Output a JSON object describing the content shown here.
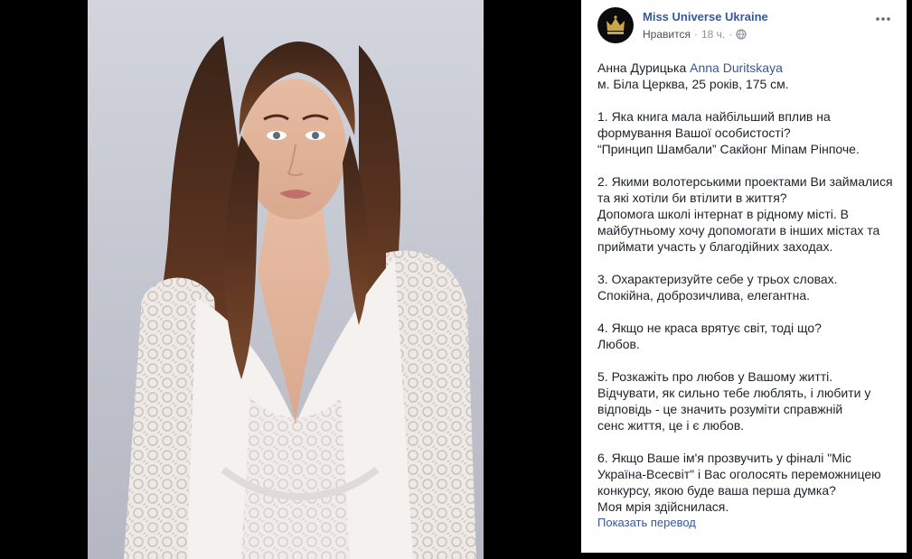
{
  "post": {
    "page_name": "Miss Universe Ukraine",
    "liked_label": "Нравится",
    "time": "18 ч.",
    "separator": "·",
    "audience_icon": "globe-icon",
    "more_icon": "more-options-icon"
  },
  "text": {
    "intro_name": "Анна Дурицька",
    "intro_mention": "Anna Duritskaya",
    "intro_line2": "м. Біла Церква, 25 років, 175 см.",
    "q1": "1. Яка книга мала найбільший вплив на",
    "q1b": "формування Вашої особистості?",
    "a1": "“Принцип Шамбали” Сакйонг Міпам Рінпоче.",
    "q2": "2. Якими волотерськими проектами Ви займалися",
    "q2b": "та які хотіли би втілити в життя?",
    "a2a": "Допомога школі інтернат в рідному місті. В",
    "a2b": "майбутньому хочу допомогати в інших містах та",
    "a2c": "приймати участь у благодійних заходах.",
    "q3": "3. Охарактеризуйте себе у трьох словах.",
    "a3": "Спокійна, доброзичлива, елегантна.",
    "q4": "4. Якщо не краса врятує світ, тоді що?",
    "a4": "Любов.",
    "q5": "5. Розкажіть про любов у Вашому житті.",
    "a5a": "Відчувати, як сильно тебе люблять, і любити у",
    "a5b": "відповідь - це значить розуміти справжній",
    "a5c": "сенс життя, це і є любов.",
    "q6a": "6. Якщо Ваше ім'я прозвучить у фіналі \"Міс",
    "q6b": "Україна-Всесвіт\" і Вас оголосять переможницею",
    "q6c": "конкурсу, якою буде ваша перша думка?",
    "a6": "Моя мрія здійснилася."
  },
  "translate_link": "Показать перевод",
  "colors": {
    "link": "#365899",
    "text": "#1d2129",
    "meta": "#90949c",
    "background": "#000000",
    "panel": "#ffffff"
  }
}
